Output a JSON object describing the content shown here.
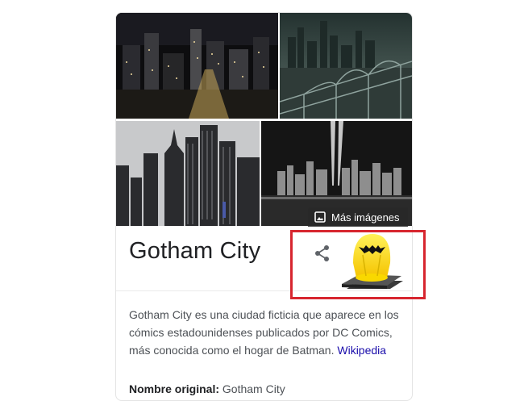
{
  "knowledge_panel": {
    "images": [
      "city-night-skyline",
      "city-bridge-dusk",
      "city-skyscrapers-gray",
      "city-skyline-light-beams"
    ],
    "more_images_label": "Más imágenes",
    "title": "Gotham City",
    "description": "Gotham City es una ciudad ficticia que aparece en los cómics estadounidenses publicados por DC Comics, más conocida como el hogar de Batman.",
    "source_link": "Wikipedia",
    "fact_label": "Nombre original:",
    "fact_value": "Gotham City"
  },
  "colors": {
    "link": "#1a0dab",
    "highlight_border": "#d7262f",
    "bat_signal": "#f5e000"
  }
}
